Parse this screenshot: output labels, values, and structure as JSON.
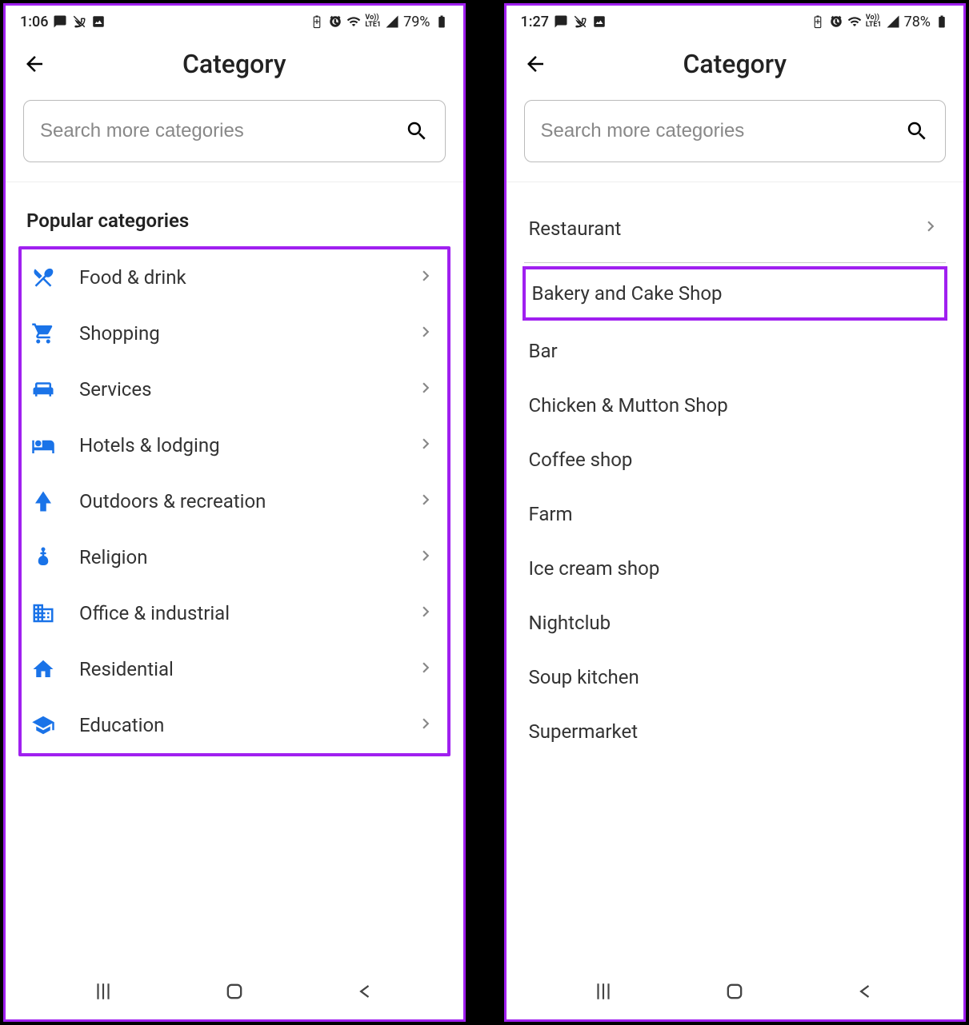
{
  "left": {
    "status": {
      "time": "1:06",
      "battery": "79%"
    },
    "title": "Category",
    "search": {
      "placeholder": "Search more categories"
    },
    "section": "Popular categories",
    "categories": [
      {
        "icon": "food",
        "label": "Food & drink"
      },
      {
        "icon": "shopping",
        "label": "Shopping"
      },
      {
        "icon": "services",
        "label": "Services"
      },
      {
        "icon": "hotel",
        "label": "Hotels & lodging"
      },
      {
        "icon": "outdoors",
        "label": "Outdoors & recreation"
      },
      {
        "icon": "religion",
        "label": "Religion"
      },
      {
        "icon": "office",
        "label": "Office & industrial"
      },
      {
        "icon": "home",
        "label": "Residential"
      },
      {
        "icon": "education",
        "label": "Education"
      }
    ]
  },
  "right": {
    "status": {
      "time": "1:27",
      "battery": "78%"
    },
    "title": "Category",
    "search": {
      "placeholder": "Search more categories"
    },
    "subcategories": [
      {
        "label": "Restaurant",
        "chevron": true,
        "divider": true
      },
      {
        "label": "Bakery and Cake Shop",
        "highlighted": true
      },
      {
        "label": "Bar"
      },
      {
        "label": "Chicken & Mutton Shop"
      },
      {
        "label": "Coffee shop"
      },
      {
        "label": "Farm"
      },
      {
        "label": "Ice cream shop"
      },
      {
        "label": "Nightclub"
      },
      {
        "label": "Soup kitchen"
      },
      {
        "label": "Supermarket"
      }
    ]
  }
}
